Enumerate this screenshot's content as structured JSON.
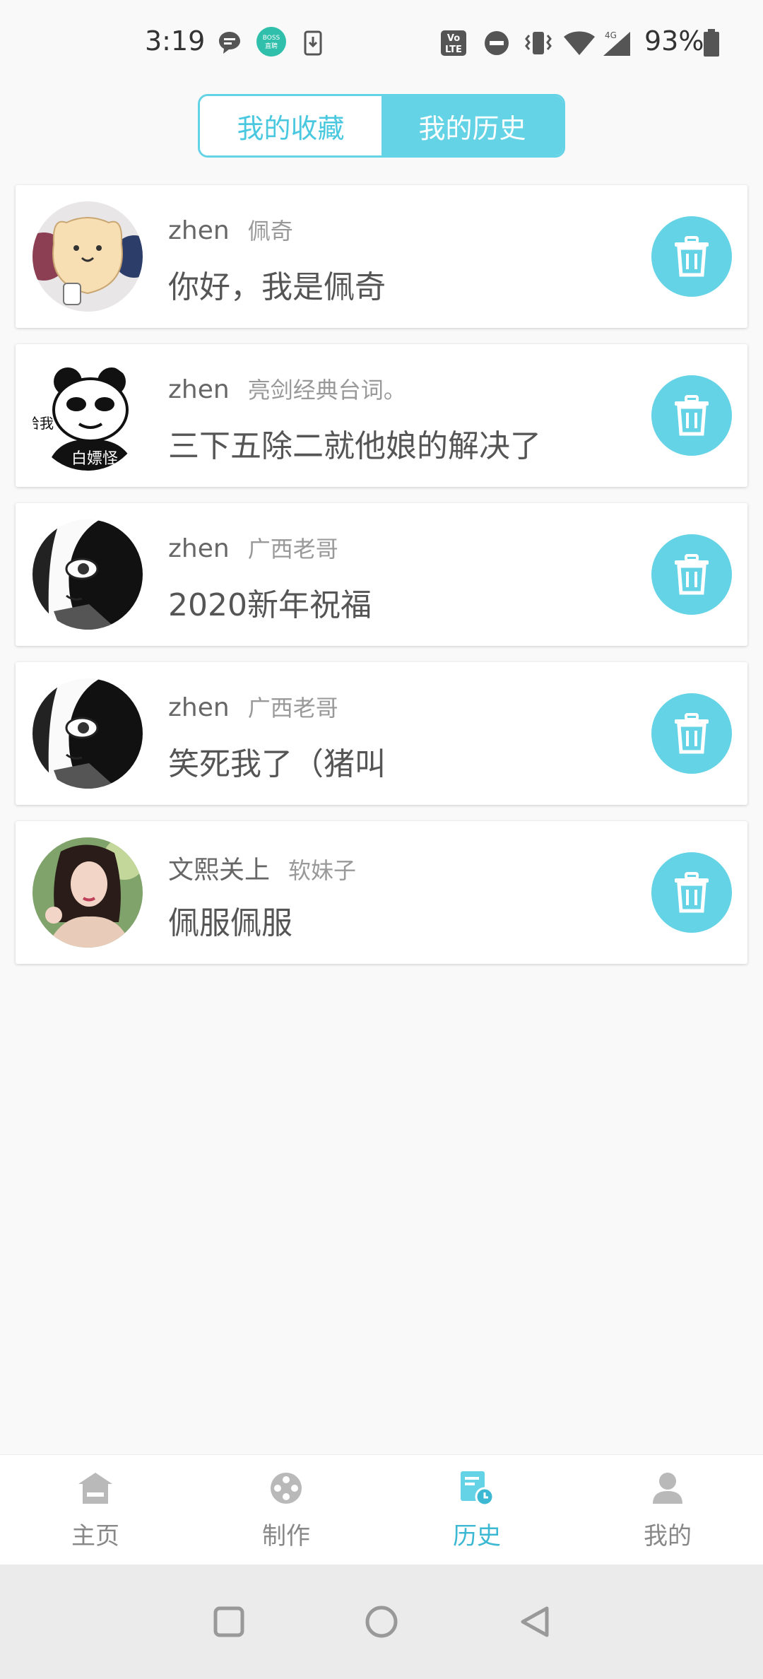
{
  "status_bar": {
    "time": "3:19",
    "battery": "93%",
    "boss_badge": "BOSS\n直聘",
    "volte": "Vo\nLTE",
    "network": "4G",
    "icons": [
      "message-icon",
      "boss-app-icon",
      "download-icon",
      "volte-icon",
      "dnd-icon",
      "vibrate-icon",
      "wifi-icon",
      "signal-icon",
      "battery-icon"
    ]
  },
  "tabs": {
    "favorites": "我的收藏",
    "history": "我的历史",
    "active": "history"
  },
  "items": [
    {
      "author": "zhen",
      "topic": "佩奇",
      "title": "你好，我是佩奇",
      "avatar": "cat-avatar"
    },
    {
      "author": "zhen",
      "topic": "亮剑经典台词。",
      "title": "三下五除二就他娘的解决了",
      "avatar": "panda-meme-avatar",
      "avatar_text_1": "白嫖怪",
      "avatar_text_2": "给我"
    },
    {
      "author": "zhen",
      "topic": "广西老哥",
      "title": "2020新年祝福",
      "avatar": "manga-girl-avatar"
    },
    {
      "author": "zhen",
      "topic": "广西老哥",
      "title": "笑死我了（猪叫",
      "avatar": "manga-girl-avatar"
    },
    {
      "author": "文熙关上",
      "topic": "软妹子",
      "title": "佩服佩服",
      "avatar": "photo-girl-avatar"
    }
  ],
  "bottom_nav": [
    {
      "label": "主页",
      "icon": "home-icon"
    },
    {
      "label": "制作",
      "icon": "film-reel-icon"
    },
    {
      "label": "历史",
      "icon": "history-icon",
      "active": true
    },
    {
      "label": "我的",
      "icon": "user-icon"
    }
  ],
  "colors": {
    "accent": "#64d3e6",
    "accent_text": "#3cb8d3",
    "background": "#f9f9f9"
  }
}
